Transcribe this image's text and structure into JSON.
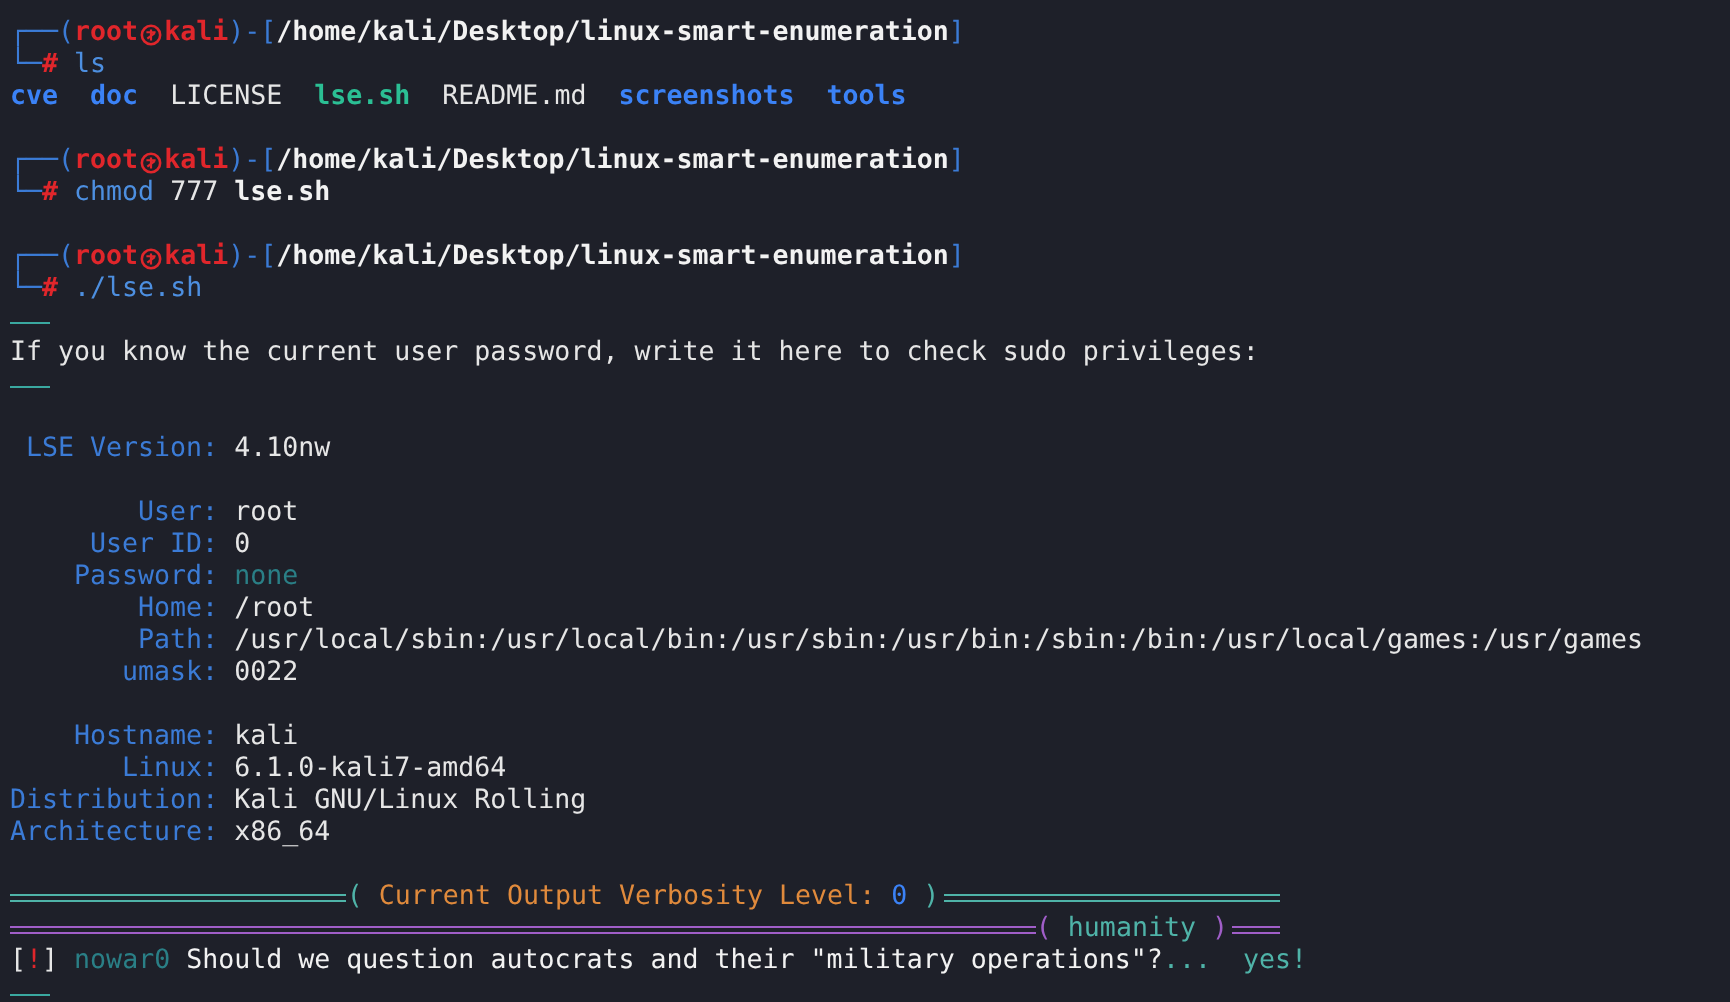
{
  "lines": [
    {
      "kind": "prompt",
      "lead": "┌──(",
      "user": "root",
      "host": "kali",
      "mid": ")-[",
      "path": "/home/kali/Desktop/linux-smart-enumeration",
      "tail": "]"
    },
    {
      "kind": "command",
      "lead": "└─",
      "sigil": "#",
      "parts": [
        {
          "text": "ls",
          "kind": "cmd"
        }
      ]
    },
    {
      "kind": "listing",
      "entries": [
        {
          "text": "cve",
          "kind": "dir"
        },
        {
          "text": "doc",
          "kind": "dir"
        },
        {
          "text": "LICENSE",
          "kind": "file"
        },
        {
          "text": "lse.sh",
          "kind": "exec"
        },
        {
          "text": "README.md",
          "kind": "file"
        },
        {
          "text": "screenshots",
          "kind": "dir"
        },
        {
          "text": "tools",
          "kind": "dir"
        }
      ]
    },
    {
      "kind": "blank"
    },
    {
      "kind": "prompt",
      "lead": "┌──(",
      "user": "root",
      "host": "kali",
      "mid": ")-[",
      "path": "/home/kali/Desktop/linux-smart-enumeration",
      "tail": "]"
    },
    {
      "kind": "command",
      "lead": "└─",
      "sigil": "#",
      "parts": [
        {
          "text": "chmod",
          "kind": "cmd"
        },
        {
          "text": "777",
          "kind": "arg"
        },
        {
          "text": "lse.sh",
          "kind": "file"
        }
      ]
    },
    {
      "kind": "blank"
    },
    {
      "kind": "prompt",
      "lead": "┌──(",
      "user": "root",
      "host": "kali",
      "mid": ")-[",
      "path": "/home/kali/Desktop/linux-smart-enumeration",
      "tail": "]"
    },
    {
      "kind": "command",
      "lead": "└─",
      "sigil": "#",
      "parts": [
        {
          "text": "./lse.sh",
          "kind": "cmd"
        }
      ]
    },
    {
      "kind": "rule"
    },
    {
      "kind": "text",
      "text": "If you know the current user password, write it here to check sudo privileges:"
    },
    {
      "kind": "rule"
    },
    {
      "kind": "blank"
    },
    {
      "kind": "field",
      "label": "LSE Version:",
      "value": "4.10nw",
      "muted": false
    },
    {
      "kind": "blank"
    },
    {
      "kind": "field",
      "label": "User:",
      "value": "root",
      "muted": false
    },
    {
      "kind": "field",
      "label": "User ID:",
      "value": "0",
      "muted": false
    },
    {
      "kind": "field",
      "label": "Password:",
      "value": "none",
      "muted": true
    },
    {
      "kind": "field",
      "label": "Home:",
      "value": "/root",
      "muted": false
    },
    {
      "kind": "field",
      "label": "Path:",
      "value": "/usr/local/sbin:/usr/local/bin:/usr/sbin:/usr/bin:/sbin:/bin:/usr/local/games:/usr/games",
      "muted": false
    },
    {
      "kind": "field",
      "label": "umask:",
      "value": "0022",
      "muted": false
    },
    {
      "kind": "blank"
    },
    {
      "kind": "field",
      "label": "Hostname:",
      "value": "kali",
      "muted": false
    },
    {
      "kind": "field",
      "label": "Linux:",
      "value": "6.1.0-kali7-amd64",
      "muted": false
    },
    {
      "kind": "field",
      "label": "Distribution:",
      "value": "Kali GNU/Linux Rolling",
      "muted": false
    },
    {
      "kind": "field",
      "label": "Architecture:",
      "value": "x86_64",
      "muted": false
    },
    {
      "kind": "blank"
    },
    {
      "kind": "verbosity",
      "open": "(",
      "title": "Current Output Verbosity Level:",
      "value": "0",
      "close": ")"
    },
    {
      "kind": "section",
      "open": "(",
      "title": "humanity",
      "close": ")"
    },
    {
      "kind": "check",
      "open": "[",
      "flag": "!",
      "close": "]",
      "tag": "nowar0",
      "text": "Should we question autocrats and their \"military operations\"?",
      "dots": "...",
      "result": "yes!"
    },
    {
      "kind": "rule"
    }
  ]
}
